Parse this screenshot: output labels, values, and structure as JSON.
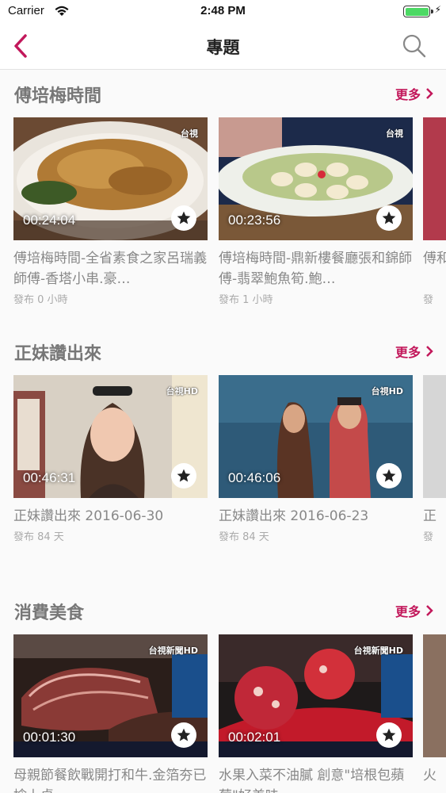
{
  "status_bar": {
    "carrier": "Carrier",
    "time": "2:48 PM"
  },
  "nav": {
    "title": "專題",
    "back_icon": "chevron-left-icon",
    "search_icon": "search-icon",
    "accent_color": "#c2185b"
  },
  "sections": [
    {
      "title": "傅培梅時間",
      "more_label": "更多",
      "cards": [
        {
          "duration": "00:24:04",
          "title": "傅培梅時間-全省素食之家呂瑞義師傅-香塔小串.豪…",
          "meta": "發布 0 小時",
          "channel_logo": "台視"
        },
        {
          "duration": "00:23:56",
          "title": "傅培梅時間-鼎新樓餐廳張和錦師傅-翡翠鮑魚筍.鮑…",
          "meta": "發布 1 小時",
          "channel_logo": "台視"
        },
        {
          "title": "傅和",
          "meta": "發"
        }
      ]
    },
    {
      "title": "正妹讚出來",
      "more_label": "更多",
      "cards": [
        {
          "duration": "00:46:31",
          "title": "正妹讚出來 2016-06-30",
          "meta": "發布 84 天",
          "channel_logo": "台視HD"
        },
        {
          "duration": "00:46:06",
          "title": "正妹讚出來 2016-06-23",
          "meta": "發布 84 天",
          "channel_logo": "台視HD"
        },
        {
          "title": "正",
          "meta": "發"
        }
      ]
    },
    {
      "title": "消費美食",
      "more_label": "更多",
      "cards": [
        {
          "duration": "00:01:30",
          "title": "母親節餐飲戰開打和牛.金箔夯已搶上桌",
          "meta": "",
          "channel_logo": "台視新聞HD"
        },
        {
          "duration": "00:02:01",
          "title": "水果入菜不油膩 創意\"培根包蘋莓\"好美味",
          "meta": "",
          "channel_logo": "台視新聞HD"
        },
        {
          "title": "火",
          "meta": ""
        }
      ]
    }
  ]
}
